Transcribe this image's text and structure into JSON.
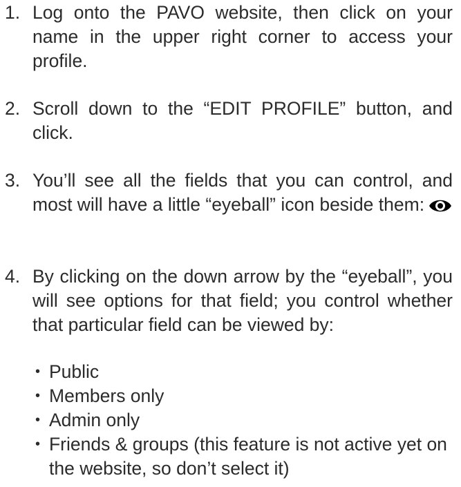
{
  "steps": [
    {
      "number": "1.",
      "text": "Log onto the PAVO website, then click on your name in the upper right corner to access your profile."
    },
    {
      "number": "2.",
      "text": "Scroll down to the “EDIT PROFILE” button, and click."
    },
    {
      "number": "3.",
      "text": "You’ll see all the fields that you can control, and most will have a little “eyeball” icon beside them:",
      "icon": "eye-icon"
    },
    {
      "number": "4.",
      "text": "By clicking on the down arrow by the “eyeball”, you will see options for that field; you control whether that particular field can be viewed by:"
    }
  ],
  "options": [
    "Public",
    "Members only",
    "Admin only",
    "Friends & groups (this feature is not active yet on the website, so don’t select it)"
  ],
  "bullet_symbol": "•"
}
